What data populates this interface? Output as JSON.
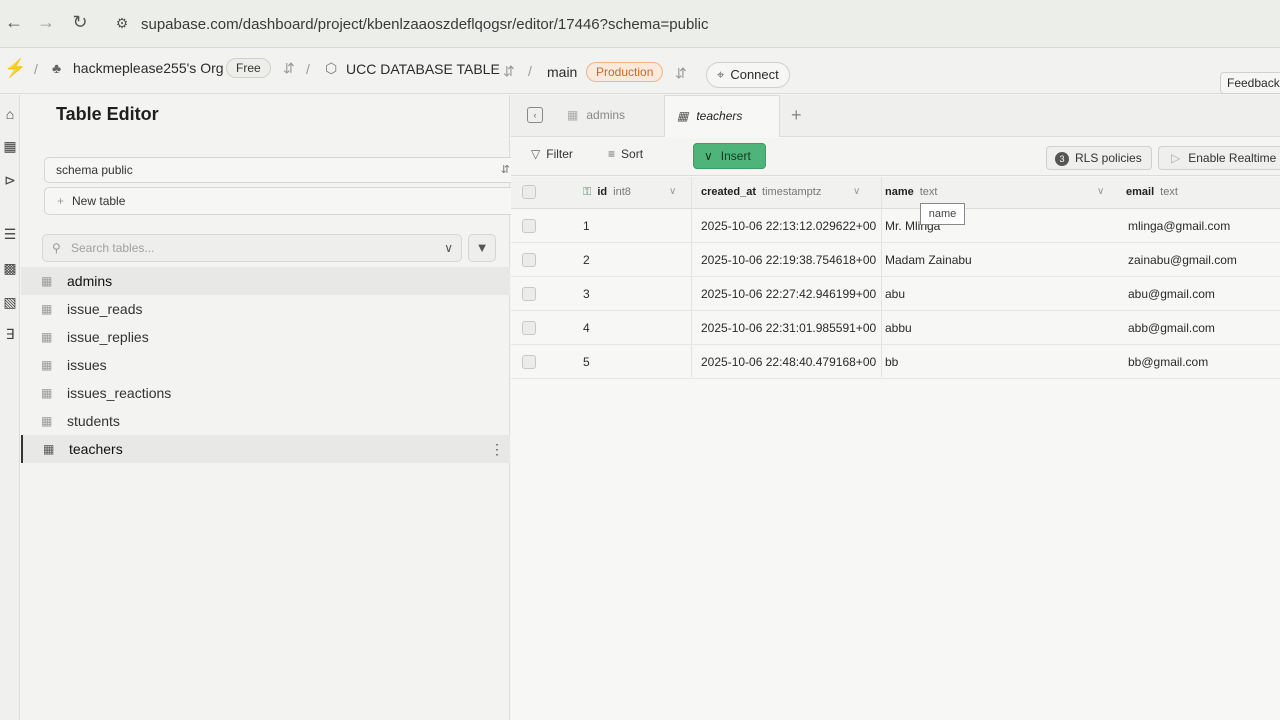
{
  "browser": {
    "url": "supabase.com/dashboard/project/kbenlzaaoszdeflqogsr/editor/17446?schema=public"
  },
  "topbar": {
    "org": "hackmeplease255's Org",
    "plan": "Free",
    "project": "UCC DATABASE TABLE",
    "branch": "main",
    "env": "Production",
    "connect": "Connect",
    "feedback": "Feedback"
  },
  "sidebar": {
    "title": "Table Editor",
    "schema": "schema public",
    "new_table": "New table",
    "search_placeholder": "Search tables...",
    "tables": [
      "admins",
      "issue_reads",
      "issue_replies",
      "issues",
      "issues_reactions",
      "students",
      "teachers"
    ],
    "active_table": "teachers"
  },
  "tabs": [
    {
      "label": "admins"
    },
    {
      "label": "teachers"
    }
  ],
  "toolbar": {
    "filter": "Filter",
    "sort": "Sort",
    "insert": "Insert",
    "rls_count": "3",
    "rls": "RLS policies",
    "realtime": "Enable Realtime"
  },
  "grid": {
    "columns": [
      {
        "name": "id",
        "type": "int8"
      },
      {
        "name": "created_at",
        "type": "timestamptz"
      },
      {
        "name": "name",
        "type": "text"
      },
      {
        "name": "email",
        "type": "text"
      }
    ],
    "tooltip": "name",
    "rows": [
      {
        "id": "1",
        "created_at": "2025-10-06 22:13:12.029622+00",
        "name": "Mr. Mlinga",
        "email": "mlinga@gmail.com"
      },
      {
        "id": "2",
        "created_at": "2025-10-06 22:19:38.754618+00",
        "name": "Madam Zainabu",
        "email": "zainabu@gmail.com"
      },
      {
        "id": "3",
        "created_at": "2025-10-06 22:27:42.946199+00",
        "name": "abu",
        "email": "abu@gmail.com"
      },
      {
        "id": "4",
        "created_at": "2025-10-06 22:31:01.985591+00",
        "name": "abbu",
        "email": "abb@gmail.com"
      },
      {
        "id": "5",
        "created_at": "2025-10-06 22:48:40.479168+00",
        "name": "bb",
        "email": "bb@gmail.com"
      }
    ]
  }
}
